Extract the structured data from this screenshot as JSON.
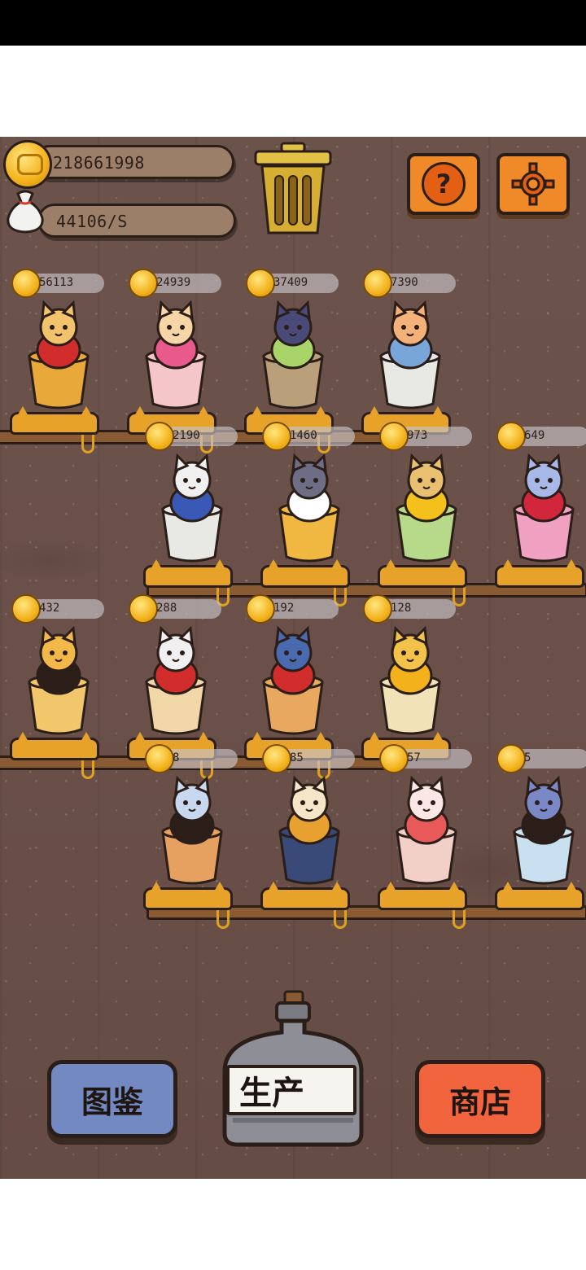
{
  "hud": {
    "coins": "218661998",
    "income_rate": "44106/S"
  },
  "buttons": {
    "help_symbol": "?",
    "collection_label": "图鉴",
    "produce_label": "生产",
    "shop_label": "商店"
  },
  "colors": {
    "wood": "#6a5048",
    "shelf": "#8a5a32",
    "coin": "#f3b21c",
    "orange_button": "#f08a28",
    "collection_button": "#7389c2",
    "shop_button": "#f2643e"
  },
  "cats": [
    {
      "value": "56113",
      "name": "red-coat-cat-cup-icon",
      "cup": "#e9a93a",
      "body": "#f2c36a",
      "accent": "#d12d2d"
    },
    {
      "value": "24939",
      "name": "pink-parfait-cat-icon",
      "cup": "#f4c6c9",
      "body": "#f6d6a6",
      "accent": "#e85a8c"
    },
    {
      "value": "37409",
      "name": "grape-glass-cat-icon",
      "cup": "#b9a07a",
      "body": "#4a4a78",
      "accent": "#a8d46a"
    },
    {
      "value": "7390",
      "name": "blue-cape-cat-icon",
      "cup": "#e8e8e4",
      "body": "#f4b27a",
      "accent": "#79a6d8"
    },
    {
      "value": "2190",
      "name": "blue-robe-cat-bowl-icon",
      "cup": "#e8e8e4",
      "body": "#f0f0f0",
      "accent": "#3a59b5"
    },
    {
      "value": "1460",
      "name": "beer-mug-cats-icon",
      "cup": "#f0b840",
      "body": "#6d6d86",
      "accent": "#ffffff"
    },
    {
      "value": "973",
      "name": "sunflower-cat-glass-icon",
      "cup": "#b6d98a",
      "body": "#e8c070",
      "accent": "#f3c01c"
    },
    {
      "value": "649",
      "name": "pink-sundae-cat-icon",
      "cup": "#f0a0c0",
      "body": "#a8b8e8",
      "accent": "#d2263c"
    },
    {
      "value": "432",
      "name": "sunglasses-cat-glass-icon",
      "cup": "#f2c66a",
      "body": "#f2b84a",
      "accent": "#2b1e18"
    },
    {
      "value": "288",
      "name": "red-jacket-cat-bowl-icon",
      "cup": "#f2d8a8",
      "body": "#f0f0f0",
      "accent": "#d12d2d"
    },
    {
      "value": "192",
      "name": "apple-hat-cat-mug-icon",
      "cup": "#e8a860",
      "body": "#4a6ab0",
      "accent": "#d12d2d"
    },
    {
      "value": "128",
      "name": "gold-coin-cat-cup-icon",
      "cup": "#f2e2b8",
      "body": "#f2c24a",
      "accent": "#f3b21c"
    },
    {
      "value": "8",
      "name": "cool-cat-bread-bowl-icon",
      "cup": "#e6a060",
      "body": "#c8d8ee",
      "accent": "#2b1e18"
    },
    {
      "value": "85",
      "name": "calico-cat-bowl-icon",
      "cup": "#3a4a78",
      "body": "#f6e6c8",
      "accent": "#e8a030"
    },
    {
      "value": "57",
      "name": "sakura-cat-bowl-icon",
      "cup": "#f2d0c8",
      "body": "#fbe8e6",
      "accent": "#e85a5a"
    },
    {
      "value": "5",
      "name": "top-hat-cat-soda-icon",
      "cup": "#c8e0f0",
      "body": "#7a88c8",
      "accent": "#2b1e18"
    }
  ]
}
